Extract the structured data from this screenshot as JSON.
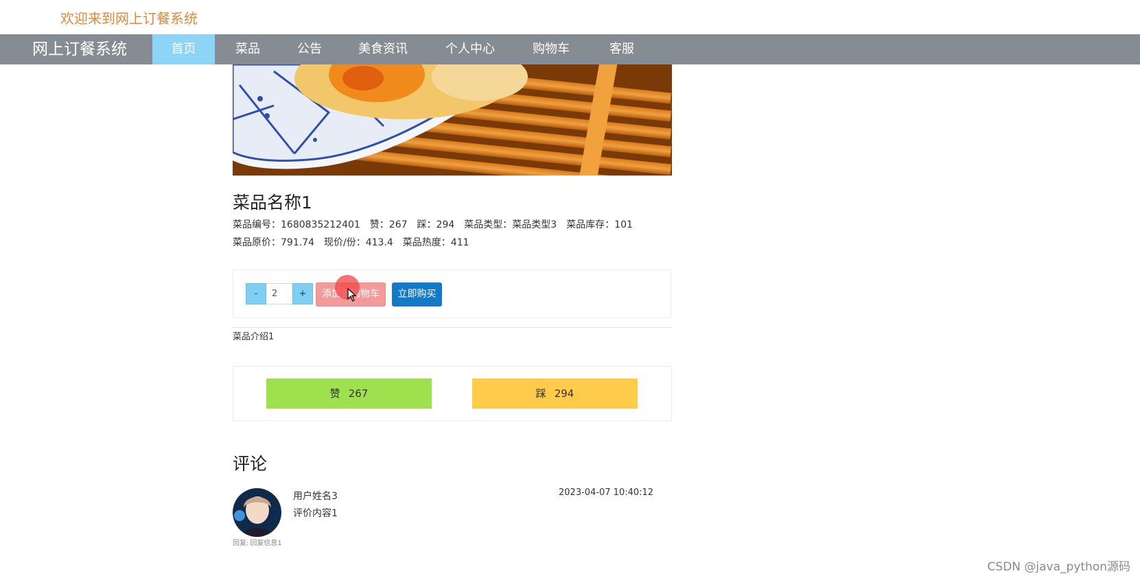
{
  "header": {
    "welcome": "欢迎来到网上订餐系统"
  },
  "nav": {
    "brand": "网上订餐系统",
    "items": [
      {
        "label": "首页",
        "active": true
      },
      {
        "label": "菜品",
        "active": false
      },
      {
        "label": "公告",
        "active": false
      },
      {
        "label": "美食资讯",
        "active": false
      },
      {
        "label": "个人中心",
        "active": false
      },
      {
        "label": "购物车",
        "active": false
      },
      {
        "label": "客服",
        "active": false
      }
    ]
  },
  "dish": {
    "name": "菜品名称1",
    "line1": {
      "code": "菜品编号：1680835212401",
      "likes": "赞：267",
      "dislikes": "踩：294",
      "type": "菜品类型：菜品类型3",
      "stock": "菜品库存：101"
    },
    "line2": {
      "original_price": "菜品原价：791.74",
      "current_price": "现价/份：413.4",
      "heat": "菜品热度：411"
    },
    "intro": "菜品介绍1"
  },
  "actions": {
    "minus": "-",
    "quantity": "2",
    "plus": "+",
    "add_to_cart": "添加到购物车",
    "buy_now": "立即购买"
  },
  "vote": {
    "like_label": "赞",
    "like_count": "267",
    "dislike_label": "踩",
    "dislike_count": "294"
  },
  "comments": {
    "title": "评论",
    "items": [
      {
        "user": "用户姓名3",
        "content": "评价内容1",
        "time": "2023-04-07 10:40:12",
        "reply_label": "回复:",
        "reply_text": "回复信息1"
      }
    ]
  },
  "watermark": "CSDN @java_python源码",
  "colors": {
    "welcome": "#e0873a",
    "navbar": "#868c93",
    "nav_active": "#8ed4f7",
    "add_cart": "#f59a9a",
    "buy_now": "#1479c6",
    "like": "#9fe04e",
    "dislike": "#ffcb4a"
  }
}
